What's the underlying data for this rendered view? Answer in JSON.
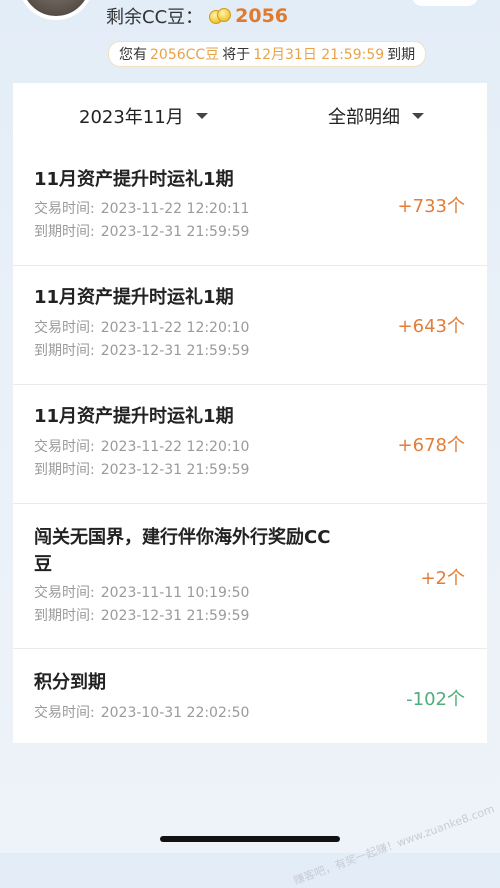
{
  "header": {
    "balance_label": "剩余CC豆：",
    "balance_value": "2056",
    "expiry": {
      "prefix": "您有",
      "amount": "2056CC豆",
      "middle": "将于",
      "date": "12月31日 21:59:59",
      "suffix": "到期"
    }
  },
  "filters": {
    "month": "2023年11月",
    "type": "全部明细"
  },
  "labels": {
    "trade_time": "交易时间:",
    "expire_time": "到期时间:"
  },
  "transactions": [
    {
      "title": "11月资产提升时运礼1期",
      "trade_time": "2023-11-22 12:20:11",
      "expire_time": "2023-12-31 21:59:59",
      "amount": "+733个"
    },
    {
      "title": "11月资产提升时运礼1期",
      "trade_time": "2023-11-22 12:20:10",
      "expire_time": "2023-12-31 21:59:59",
      "amount": "+643个"
    },
    {
      "title": "11月资产提升时运礼1期",
      "trade_time": "2023-11-22 12:20:10",
      "expire_time": "2023-12-31 21:59:59",
      "amount": "+678个"
    },
    {
      "title": "闯关无国界，建行伴你海外行奖励CC豆",
      "trade_time": "2023-11-11 10:19:50",
      "expire_time": "2023-12-31 21:59:59",
      "amount": "+2个"
    },
    {
      "title": "积分到期",
      "trade_time": "2023-10-31 22:02:50",
      "amount": "-102个"
    }
  ],
  "watermark": "赚客吧，有奖一起赚！www.zuanke8.com",
  "colors": {
    "accent": "#e07a2e",
    "negative": "#4fae7a",
    "highlight": "#e8a348"
  },
  "icons": {
    "coin": "coin-icon",
    "dropdown": "chevron-down-icon"
  }
}
